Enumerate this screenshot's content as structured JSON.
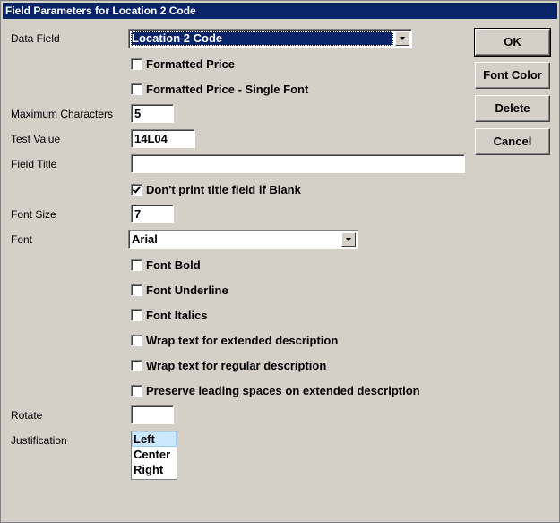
{
  "window": {
    "title": "Field Parameters for Location 2 Code"
  },
  "labels": {
    "data_field": "Data Field",
    "max_chars": "Maximum Characters",
    "test_value": "Test Value",
    "field_title": "Field Title",
    "font_size": "Font Size",
    "font": "Font",
    "rotate": "Rotate",
    "justification": "Justification"
  },
  "fields": {
    "data_field_value": "Location 2 Code",
    "max_chars_value": "5",
    "test_value_value": "14L04",
    "field_title_value": "",
    "font_size_value": "7",
    "font_value": "Arial",
    "rotate_value": ""
  },
  "checkboxes": {
    "formatted_price": {
      "label": "Formatted Price",
      "checked": false
    },
    "formatted_price_single": {
      "label": "Formatted Price - Single Font",
      "checked": false
    },
    "dont_print_title": {
      "label": "Don't print title field if Blank",
      "checked": true
    },
    "font_bold": {
      "label": "Font Bold",
      "checked": false
    },
    "font_underline": {
      "label": "Font Underline",
      "checked": false
    },
    "font_italics": {
      "label": "Font Italics",
      "checked": false
    },
    "wrap_extended": {
      "label": "Wrap text for extended description",
      "checked": false
    },
    "wrap_regular": {
      "label": "Wrap text for regular description",
      "checked": false
    },
    "preserve_spaces": {
      "label": "Preserve leading spaces on extended description",
      "checked": false
    }
  },
  "justification_options": [
    "Left",
    "Center",
    "Right"
  ],
  "justification_selected": "Left",
  "buttons": {
    "ok": "OK",
    "font_color": "Font Color",
    "delete": "Delete",
    "cancel": "Cancel"
  },
  "colors": {
    "title_bar": "#0a246a",
    "dialog_bg": "#d4d0c8",
    "list_selection": "#cce8ff"
  }
}
